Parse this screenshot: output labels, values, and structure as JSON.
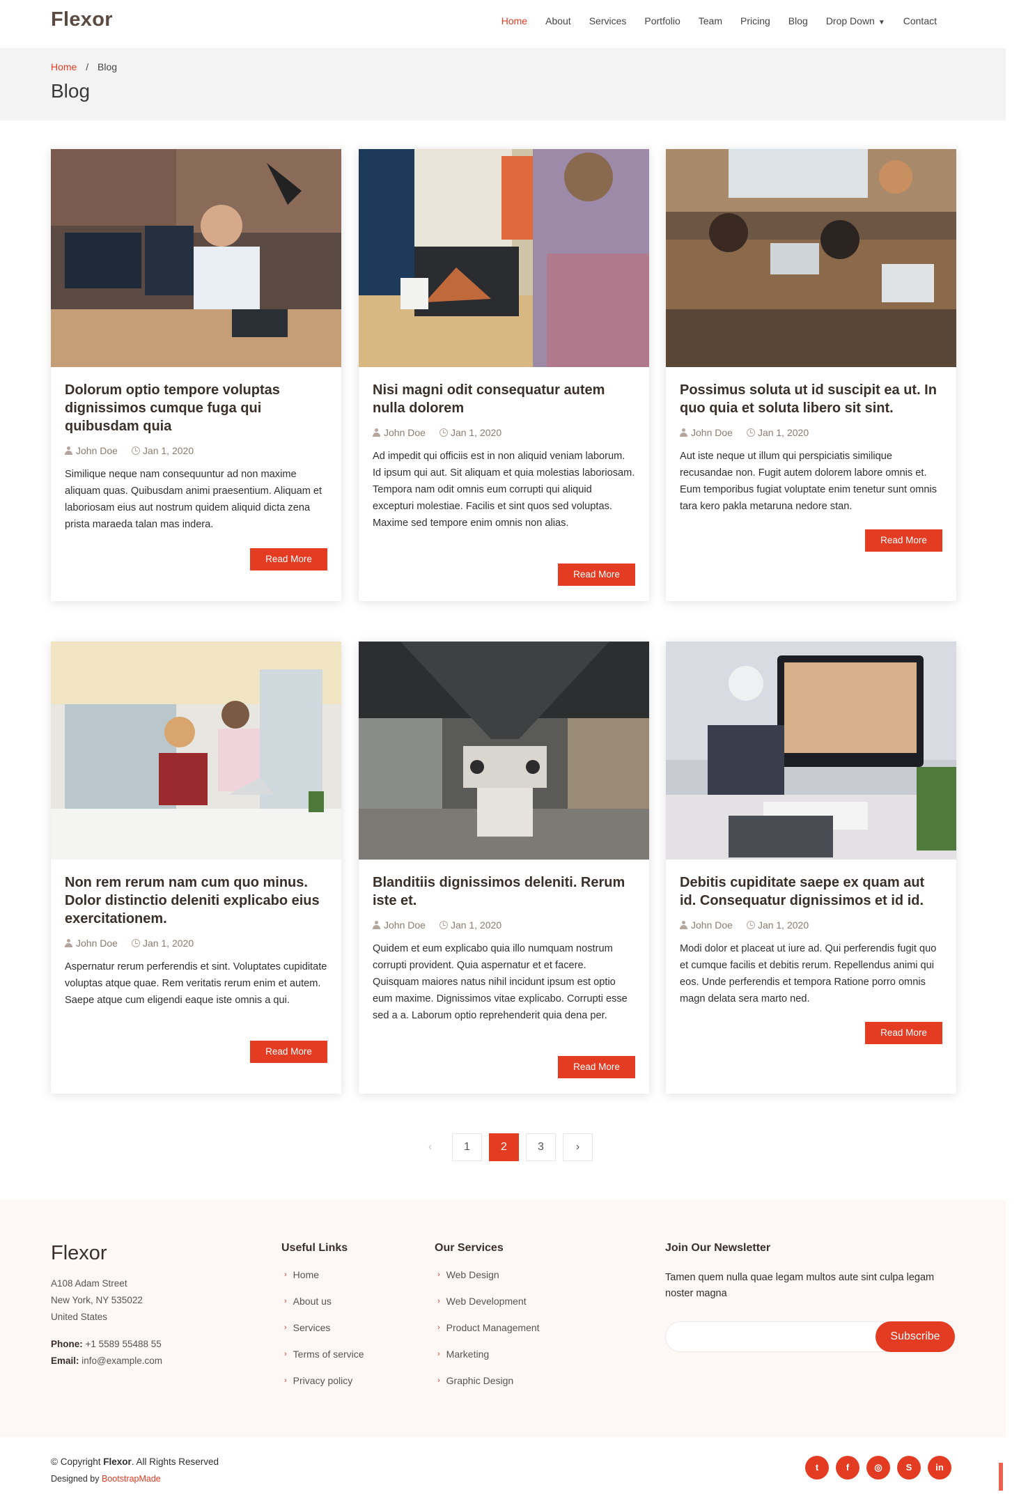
{
  "header": {
    "logo": "Flexor",
    "nav": [
      {
        "label": "Home",
        "active": true
      },
      {
        "label": "About"
      },
      {
        "label": "Services"
      },
      {
        "label": "Portfolio"
      },
      {
        "label": "Team"
      },
      {
        "label": "Pricing"
      },
      {
        "label": "Blog"
      },
      {
        "label": "Drop Down",
        "icon": "chevron-down-icon"
      },
      {
        "label": "Contact"
      }
    ]
  },
  "breadcrumb": {
    "home": "Home",
    "separator": "/",
    "current": "Blog",
    "title": "Blog"
  },
  "posts": [
    {
      "title": "Dolorum optio tempore voluptas dignissimos cumque fuga qui quibusdam quia",
      "author": "John Doe",
      "date": "Jan 1, 2020",
      "excerpt": "Similique neque nam consequuntur ad non maxime aliquam quas. Quibusdam animi praesentium. Aliquam et laboriosam eius aut nostrum quidem aliquid dicta zena prista maraeda talan mas indera.",
      "button": "Read More",
      "image": "man-with-headset-at-computer-photo"
    },
    {
      "title": "Nisi magni odit consequatur autem nulla dolorem",
      "author": "John Doe",
      "date": "Jan 1, 2020",
      "excerpt": "Ad impedit qui officiis est in non aliquid veniam laborum. Id ipsum qui aut. Sit aliquam et quia molestias laboriosam. Tempora nam odit omnis eum corrupti qui aliquid excepturi molestiae. Facilis et sint quos sed voluptas. Maxime sed tempore enim omnis non alias.",
      "button": "Read More",
      "image": "man-typing-on-laptop-photo"
    },
    {
      "title": "Possimus soluta ut id suscipit ea ut. In quo quia et soluta libero sit sint.",
      "author": "John Doe",
      "date": "Jan 1, 2020",
      "excerpt": "Aut iste neque ut illum qui perspiciatis similique recusandae non. Fugit autem dolorem labore omnis et. Eum temporibus fugiat voluptate enim tenetur sunt omnis tara kero pakla metaruna nedore stan.",
      "button": "Read More",
      "image": "team-working-on-laptops-photo"
    },
    {
      "title": "Non rem rerum nam cum quo minus. Dolor distinctio deleniti explicabo eius exercitationem.",
      "author": "John Doe",
      "date": "Jan 1, 2020",
      "excerpt": "Aspernatur rerum perferendis et sint. Voluptates cupiditate voluptas atque quae. Rem veritatis rerum enim et autem. Saepe atque cum eligendi eaque iste omnis a qui.",
      "button": "Read More",
      "image": "two-colleagues-at-laptop-photo"
    },
    {
      "title": "Blanditiis dignissimos deleniti. Rerum iste et.",
      "author": "John Doe",
      "date": "Jan 1, 2020",
      "excerpt": "Quidem et eum explicabo quia illo numquam nostrum corrupti provident. Quia aspernatur et et facere. Quisquam maiores natus nihil incidunt ipsum est optio eum maxime. Dignissimos vitae explicabo. Corrupti esse sed a a. Laborum optio reprehenderit quia dena per.",
      "button": "Read More",
      "image": "open-plan-office-photo"
    },
    {
      "title": "Debitis cupiditate saepe ex quam aut id. Consequatur dignissimos et id id.",
      "author": "John Doe",
      "date": "Jan 1, 2020",
      "excerpt": "Modi dolor et placeat ut iure ad. Qui perferendis fugit quo et cumque facilis et debitis rerum. Repellendus animi qui eos. Unde perferendis et tempora Ratione porro omnis magn delata sera marto ned.",
      "button": "Read More",
      "image": "desktop-workspace-photo"
    }
  ],
  "pagination": {
    "prev": "‹",
    "pages": [
      "1",
      "2",
      "3"
    ],
    "current": "2",
    "next": "›"
  },
  "footer": {
    "logo": "Flexor",
    "address": [
      "A108 Adam Street",
      "New York, NY 535022",
      "United States"
    ],
    "phone_label": "Phone:",
    "phone": "+1 5589 55488 55",
    "email_label": "Email:",
    "email": "info@example.com",
    "useful_links": {
      "heading": "Useful Links",
      "items": [
        "Home",
        "About us",
        "Services",
        "Terms of service",
        "Privacy policy"
      ]
    },
    "services": {
      "heading": "Our Services",
      "items": [
        "Web Design",
        "Web Development",
        "Product Management",
        "Marketing",
        "Graphic Design"
      ]
    },
    "newsletter": {
      "heading": "Join Our Newsletter",
      "text": "Tamen quem nulla quae legam multos aute sint culpa legam noster magna",
      "button": "Subscribe",
      "input_value": ""
    },
    "copyright_prefix": "© Copyright",
    "copyright_brand": "Flexor",
    "copyright_suffix": ". All Rights Reserved",
    "designed_by_label": "Designed by",
    "designed_by": "BootstrapMade",
    "socials": [
      {
        "icon": "twitter-icon",
        "glyph": "t"
      },
      {
        "icon": "facebook-icon",
        "glyph": "f"
      },
      {
        "icon": "instagram-icon",
        "glyph": "◎"
      },
      {
        "icon": "skype-icon",
        "glyph": "S"
      },
      {
        "icon": "linkedin-icon",
        "glyph": "in"
      }
    ]
  },
  "colors": {
    "accent": "#e43c22",
    "heading": "#3b2f2a",
    "breadcrumb_bg": "#f4f3f3",
    "footer_bg": "#fdf7f5"
  }
}
